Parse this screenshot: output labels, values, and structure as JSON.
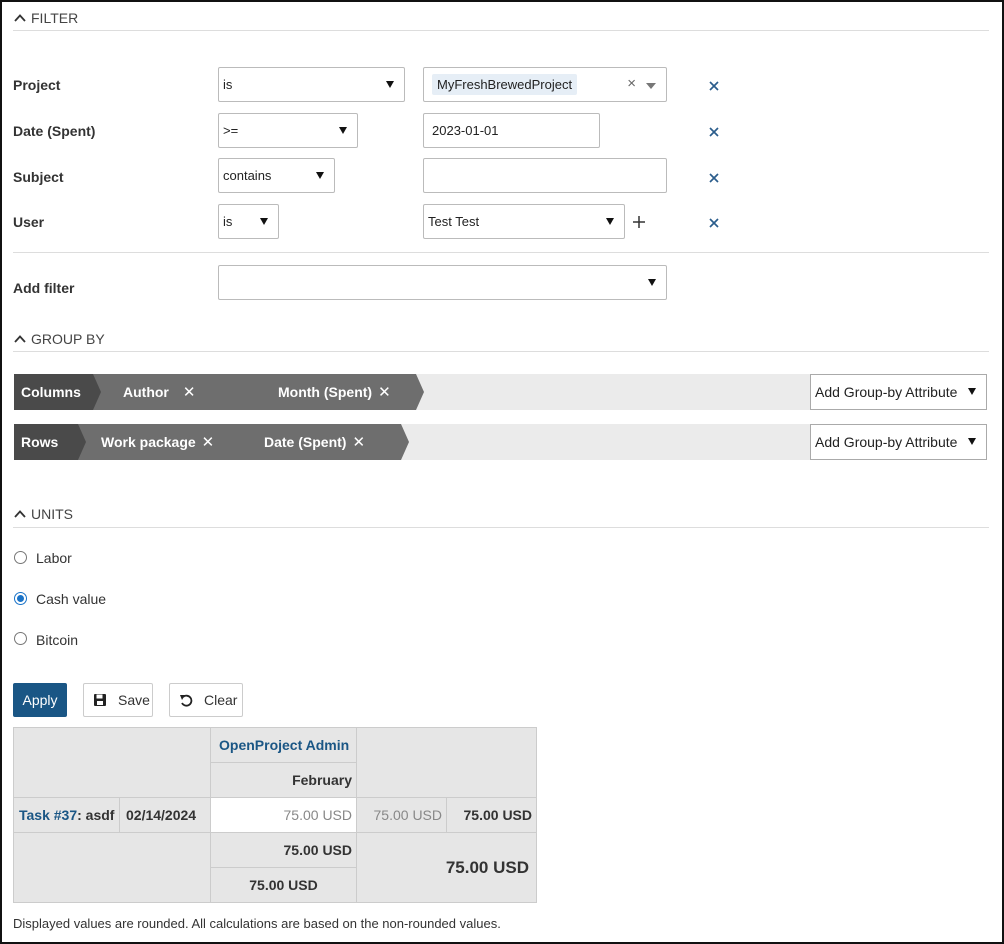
{
  "filter": {
    "section_title": "FILTER",
    "rows": [
      {
        "label": "Project",
        "operator": "is",
        "value_chip": "MyFreshBrewedProject"
      },
      {
        "label": "Date (Spent)",
        "operator": ">=",
        "value": "2023-01-01"
      },
      {
        "label": "Subject",
        "operator": "contains",
        "value": ""
      },
      {
        "label": "User",
        "operator": "is",
        "value": "Test Test"
      }
    ],
    "add_filter_label": "Add filter",
    "add_filter_value": ""
  },
  "group_by": {
    "section_title": "GROUP BY",
    "columns_label": "Columns",
    "columns": [
      "Author",
      "Month (Spent)"
    ],
    "rows_label": "Rows",
    "rows": [
      "Work package",
      "Date (Spent)"
    ],
    "add_attribute_label": "Add Group-by Attribute"
  },
  "units": {
    "section_title": "UNITS",
    "options": [
      "Labor",
      "Cash value",
      "Bitcoin"
    ],
    "selected": "Cash value"
  },
  "actions": {
    "apply": "Apply",
    "save": "Save",
    "clear": "Clear"
  },
  "result_table": {
    "column_group": "OpenProject Admin",
    "column_sub": "February",
    "row_task_link": "Task #37",
    "row_task_rest": ": asdf",
    "row_date": "02/14/2024",
    "cell_value": "75.00 USD",
    "row_subtotal": "75.00 USD",
    "row_total": "75.00 USD",
    "col_total": "75.00 USD",
    "col_total_2": "75.00 USD",
    "grand_total": "75.00 USD"
  },
  "footnote": "Displayed values are rounded. All calculations are based on the non-rounded values.",
  "colors": {
    "accent": "#1a5685",
    "segment_dark": "#4a4a4a",
    "segment_mid": "#6e6e6e",
    "remove_x": "#2b5d8c"
  },
  "icons": {
    "collapse": "chevron-up-icon",
    "remove": "close-icon",
    "add": "plus-icon",
    "save": "floppy-disk-icon",
    "clear": "undo-icon"
  }
}
